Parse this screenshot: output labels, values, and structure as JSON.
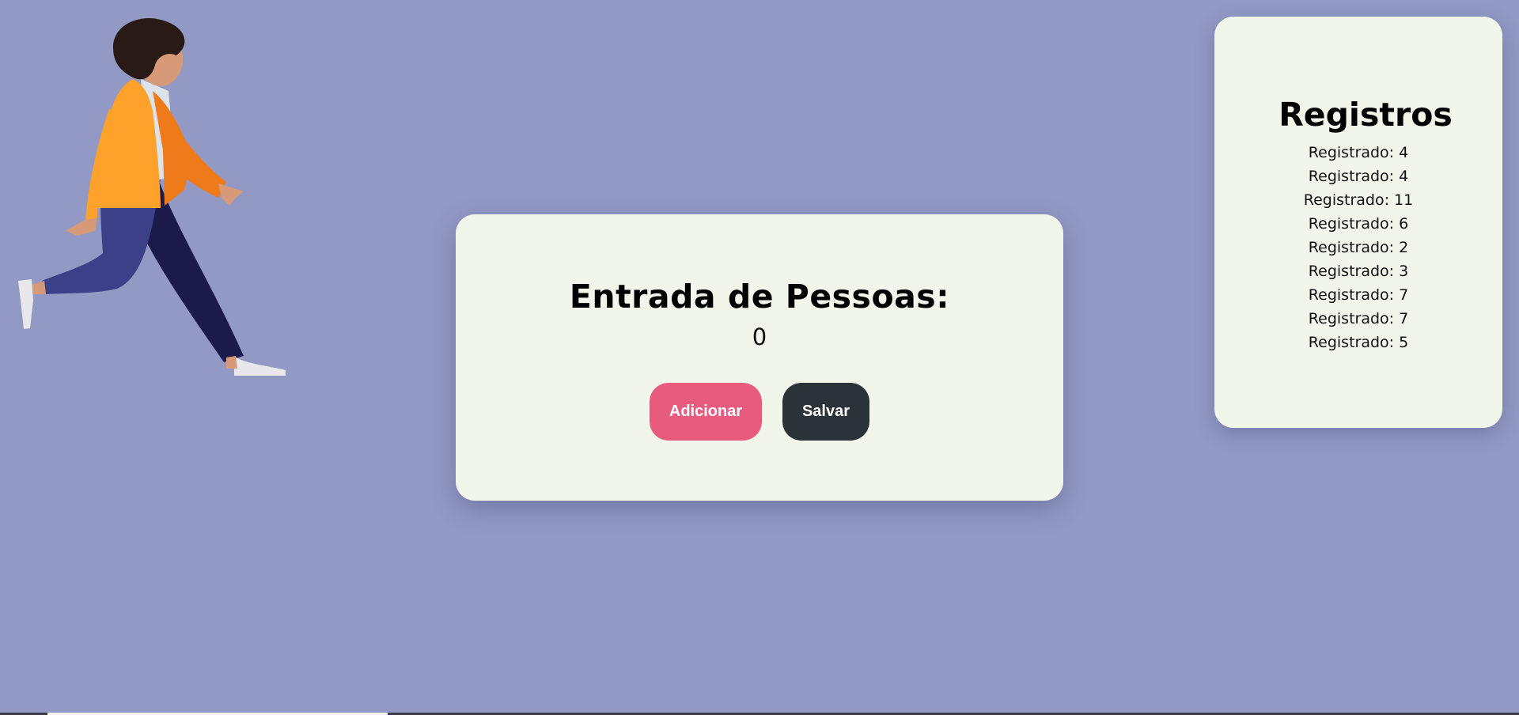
{
  "counter": {
    "title": "Entrada de Pessoas:",
    "value": "0",
    "add_label": "Adicionar",
    "save_label": "Salvar"
  },
  "records": {
    "title": "Registros",
    "items": [
      "Registrado: 4",
      "Registrado: 4",
      "Registrado: 11",
      "Registrado: 6",
      "Registrado: 2",
      "Registrado: 3",
      "Registrado: 7",
      "Registrado: 7",
      "Registrado: 5"
    ]
  },
  "illustration": {
    "icon": "walking-person-icon"
  },
  "colors": {
    "background": "#9199c4",
    "card": "#f1f5ea",
    "add_button": "#e85b7e",
    "save_button": "#2b3339"
  }
}
